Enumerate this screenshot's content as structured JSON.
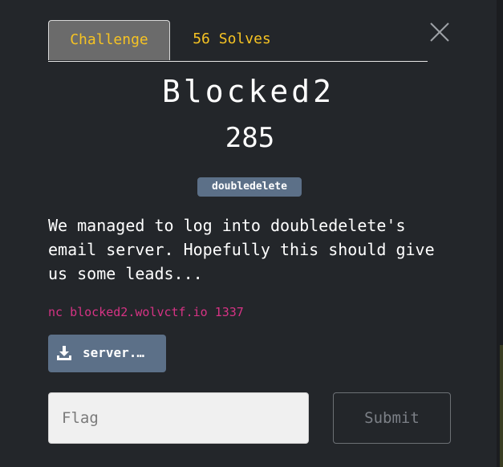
{
  "tabs": [
    {
      "label": "Challenge",
      "active": true
    },
    {
      "label": "56 Solves",
      "active": false
    }
  ],
  "challenge": {
    "name": "Blocked2",
    "points": "285",
    "tag": "doubledelete",
    "description": "We managed to log into doubledelete's\nemail server. Hopefully this should give\nus some leads...",
    "connection": "nc blocked2.wolvctf.io 1337",
    "file_label": "server.…"
  },
  "form": {
    "flag_placeholder": "Flag",
    "flag_value": "",
    "submit_label": "Submit"
  },
  "icons": {
    "close": "close-icon",
    "download": "download-icon"
  },
  "colors": {
    "background": "#23262a",
    "tab_text": "#f6c323",
    "tag_bg": "#5c7088",
    "connection_text": "#d63384"
  }
}
